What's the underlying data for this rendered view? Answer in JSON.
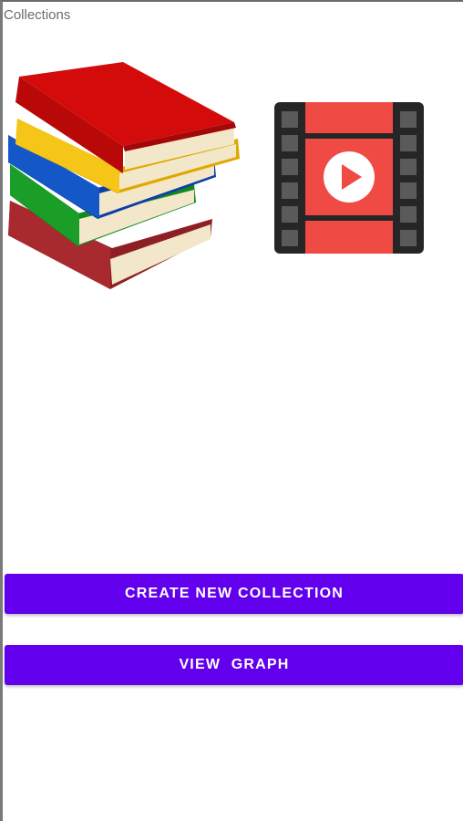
{
  "app": {
    "title": "Collections"
  },
  "icons": {
    "books": "books-stack-icon",
    "movie": "movie-film-icon"
  },
  "buttons": {
    "create_label": "CREATE NEW COLLECTION",
    "graph_label": "VIEW GRAPH"
  },
  "colors": {
    "button_bg": "#6200ee",
    "button_text": "#ffffff",
    "film_red": "#f04a45",
    "film_frame": "#262626"
  }
}
